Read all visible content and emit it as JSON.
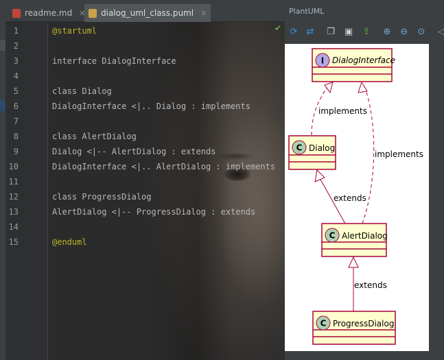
{
  "tabs": [
    {
      "label": "readme.md",
      "icon": "markdown-file-icon",
      "active": false
    },
    {
      "label": "dialog_uml_class.puml",
      "icon": "puml-file-icon",
      "active": true
    }
  ],
  "editor": {
    "lines": [
      {
        "num": "1",
        "kw": "@startuml",
        "text": ""
      },
      {
        "num": "2",
        "kw": "",
        "text": ""
      },
      {
        "num": "3",
        "kw": "",
        "text": "interface DialogInterface"
      },
      {
        "num": "4",
        "kw": "",
        "text": ""
      },
      {
        "num": "5",
        "kw": "",
        "text": "class Dialog"
      },
      {
        "num": "6",
        "kw": "",
        "text": "DialogInterface <|.. Dialog : implements"
      },
      {
        "num": "7",
        "kw": "",
        "text": ""
      },
      {
        "num": "8",
        "kw": "",
        "text": "class AlertDialog"
      },
      {
        "num": "9",
        "kw": "",
        "text": "Dialog <|-- AlertDialog : extends"
      },
      {
        "num": "10",
        "kw": "",
        "text": "DialogInterface <|.. AlertDialog : implements"
      },
      {
        "num": "11",
        "kw": "",
        "text": ""
      },
      {
        "num": "12",
        "kw": "",
        "text": "class ProgressDialog"
      },
      {
        "num": "13",
        "kw": "",
        "text": "AlertDialog <|-- ProgressDialog : extends"
      },
      {
        "num": "14",
        "kw": "",
        "text": ""
      },
      {
        "num": "15",
        "kw": "@enduml",
        "text": ""
      }
    ]
  },
  "panel": {
    "title": "PlantUML",
    "toolbar_icons": [
      "refresh-icon",
      "sync-icon",
      "copy-icon",
      "save-icon",
      "export-icon",
      "zoom-in-icon",
      "zoom-out-icon",
      "zoom-actual-icon",
      "arrow-left-icon"
    ]
  },
  "diagram": {
    "interface_marker": "I",
    "class_marker": "C",
    "classes": {
      "dialog_interface": "DialogInterface",
      "dialog": "Dialog",
      "alert_dialog": "AlertDialog",
      "progress_dialog": "ProgressDialog"
    },
    "relations": {
      "dialog_implements": "implements",
      "alert_implements": "implements",
      "alert_extends": "extends",
      "progress_extends": "extends"
    }
  },
  "colors": {
    "class_fill": "#fefece",
    "class_border": "#a80036",
    "class_circle": "#add1b2",
    "interface_circle": "#b4a7e5",
    "keyword": "#bbb529",
    "check": "#5fb34a"
  }
}
